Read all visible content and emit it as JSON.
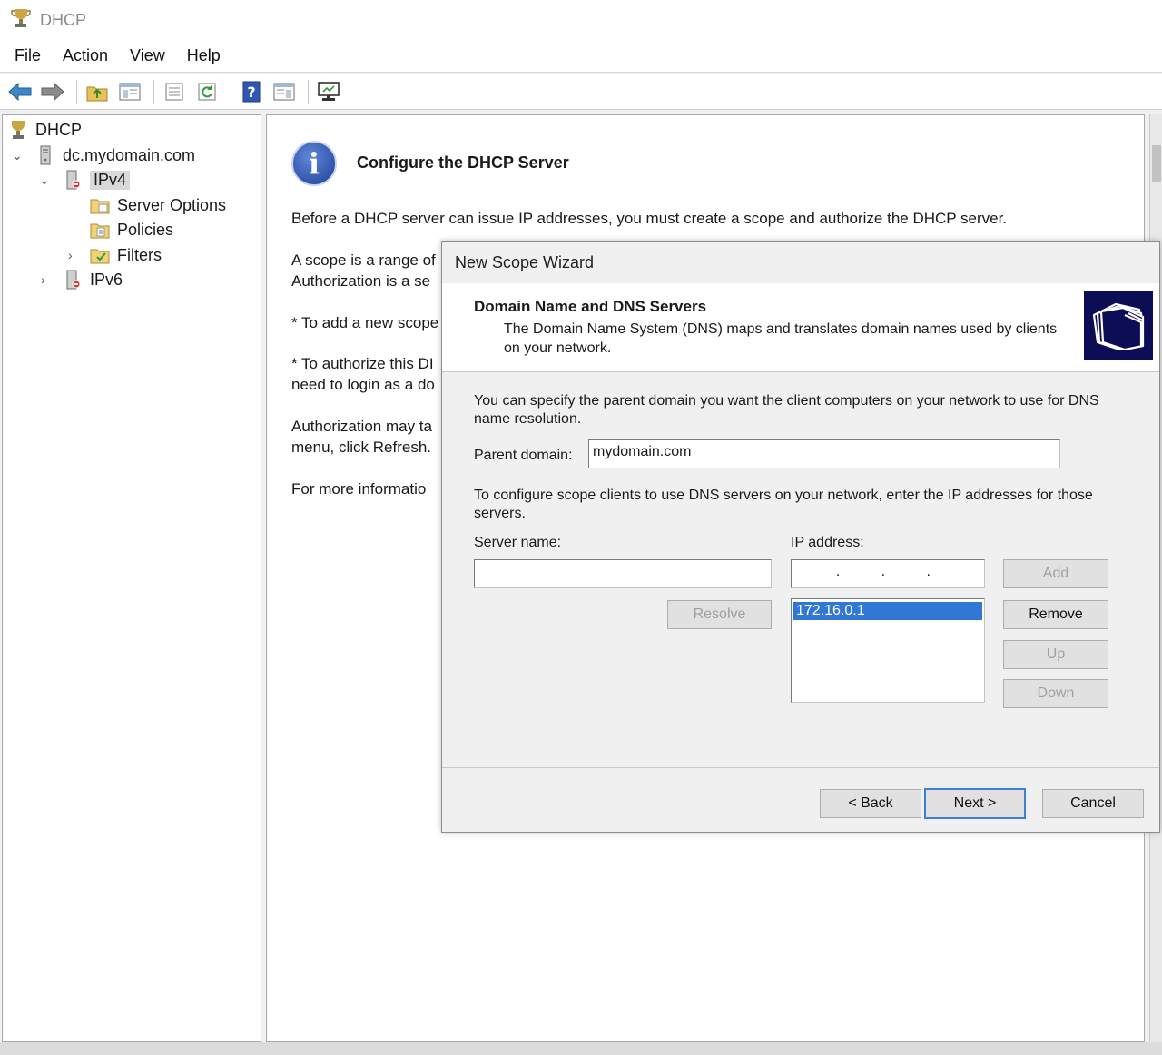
{
  "window": {
    "title": "DHCP",
    "app_icon": "dhcp-trophy-icon"
  },
  "menu": [
    "File",
    "Action",
    "View",
    "Help"
  ],
  "toolbar": {
    "icons": [
      "back-arrow-icon",
      "forward-arrow-icon",
      "up-folder-icon",
      "show-hide-tree-icon",
      "properties-icon",
      "refresh-icon",
      "help-icon",
      "details-view-icon",
      "monitor-icon"
    ]
  },
  "tree": {
    "root": "DHCP",
    "server": "dc.mydomain.com",
    "ipv4": "IPv4",
    "server_options": "Server Options",
    "policies": "Policies",
    "filters": "Filters",
    "ipv6": "IPv6"
  },
  "content": {
    "heading": "Configure the DHCP Server",
    "para1": "Before a DHCP server can issue IP addresses, you must create a scope and authorize the DHCP server.",
    "para2_line1": "A scope is a range of",
    "para2_line2": "Authorization is a se",
    "para3": "* To add a new scope",
    "para4_line1": "* To authorize this DI",
    "para4_line2": "need to login as a do",
    "para5_line1": "Authorization may ta",
    "para5_line2": "menu, click Refresh.",
    "para6": "For more informatio"
  },
  "wizard": {
    "title": "New Scope Wizard",
    "header_title": "Domain Name and DNS Servers",
    "header_subtitle": "The Domain Name System (DNS) maps and translates domain names used by clients on your network.",
    "intro": "You can specify the parent domain you want the client computers on your network to use for DNS name resolution.",
    "parent_domain_label": "Parent domain:",
    "parent_domain_value": "mydomain.com",
    "dns_intro": "To configure scope clients to use DNS servers on your network, enter the IP addresses for those servers.",
    "server_name_label": "Server name:",
    "server_name_value": "",
    "ip_address_label": "IP address:",
    "ip_address_value": "  .   .   .  ",
    "ip_list": [
      "172.16.0.1"
    ],
    "buttons": {
      "add": "Add",
      "resolve": "Resolve",
      "remove": "Remove",
      "up": "Up",
      "down": "Down",
      "back": "< Back",
      "next": "Next >",
      "cancel": "Cancel"
    }
  },
  "colors": {
    "selection": "#3178d6",
    "default_button_border": "#3c7fd4",
    "header_logo_bg": "#0d0d55",
    "info_icon": "#1d3f98"
  }
}
